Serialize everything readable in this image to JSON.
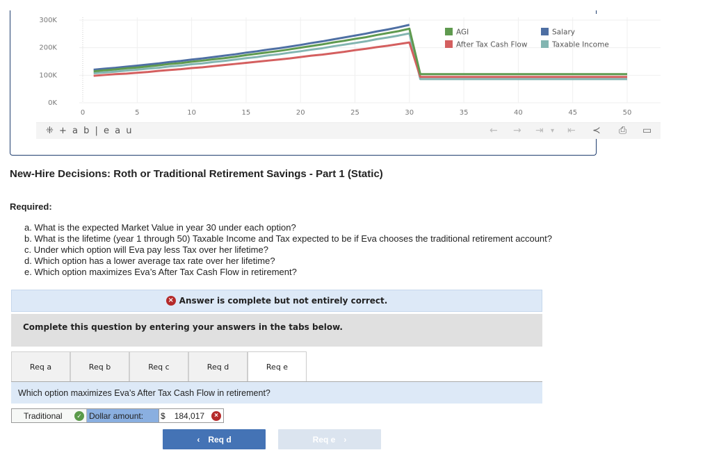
{
  "chart_data": {
    "type": "line",
    "title": "",
    "xlabel": "",
    "ylabel": "",
    "xlim": [
      -3,
      53
    ],
    "ylim": [
      0,
      300000
    ],
    "x_ticks": [
      0,
      5,
      10,
      15,
      20,
      25,
      30,
      35,
      40,
      45,
      50
    ],
    "x_tick_labels": [
      "0",
      "5",
      "10",
      "15",
      "20",
      "25",
      "30",
      "35",
      "40",
      "45",
      "50"
    ],
    "y_ticks": [
      0,
      100000,
      200000,
      300000
    ],
    "y_tick_labels": [
      "0K",
      "100K",
      "200K",
      "300K"
    ],
    "grid": true,
    "legend_position": "top-right",
    "series": [
      {
        "name": "Salary",
        "color": "#4e6fa3",
        "x": [
          1,
          2,
          3,
          4,
          5,
          6,
          7,
          8,
          9,
          10,
          11,
          12,
          13,
          14,
          15,
          16,
          17,
          18,
          19,
          20,
          21,
          22,
          23,
          24,
          25,
          26,
          27,
          28,
          29,
          30
        ],
        "values": [
          120000,
          124000,
          127000,
          131000,
          135000,
          139000,
          143000,
          148000,
          152000,
          157000,
          161000,
          166000,
          171000,
          176000,
          182000,
          187000,
          193000,
          198000,
          204000,
          210000,
          217000,
          223000,
          230000,
          237000,
          244000,
          251000,
          259000,
          266000,
          274000,
          283000
        ]
      },
      {
        "name": "AGI",
        "color": "#5f9a4f",
        "x": [
          1,
          2,
          3,
          4,
          5,
          6,
          7,
          8,
          9,
          10,
          11,
          12,
          13,
          14,
          15,
          16,
          17,
          18,
          19,
          20,
          21,
          22,
          23,
          24,
          25,
          26,
          27,
          28,
          29,
          30,
          31,
          32,
          33,
          34,
          35,
          36,
          37,
          38,
          39,
          40,
          41,
          42,
          43,
          44,
          45,
          46,
          47,
          48,
          49,
          50
        ],
        "values": [
          114000,
          118000,
          121000,
          125000,
          128000,
          132000,
          136000,
          141000,
          144000,
          149000,
          153000,
          158000,
          162000,
          167000,
          173000,
          178000,
          183000,
          188000,
          194000,
          200000,
          206000,
          212000,
          219000,
          225000,
          232000,
          238000,
          246000,
          253000,
          260000,
          269000,
          104000,
          104000,
          104000,
          104000,
          104000,
          104000,
          104000,
          104000,
          104000,
          104000,
          104000,
          104000,
          104000,
          104000,
          104000,
          104000,
          104000,
          104000,
          104000,
          104000
        ]
      },
      {
        "name": "Taxable Income",
        "color": "#82b5b1",
        "x": [
          1,
          2,
          3,
          4,
          5,
          6,
          7,
          8,
          9,
          10,
          11,
          12,
          13,
          14,
          15,
          16,
          17,
          18,
          19,
          20,
          21,
          22,
          23,
          24,
          25,
          26,
          27,
          28,
          29,
          30,
          31,
          32,
          33,
          34,
          35,
          36,
          37,
          38,
          39,
          40,
          41,
          42,
          43,
          44,
          45,
          46,
          47,
          48,
          49,
          50
        ],
        "values": [
          107000,
          110000,
          113000,
          117000,
          120000,
          124000,
          127000,
          132000,
          135000,
          140000,
          143000,
          148000,
          152000,
          157000,
          162000,
          166000,
          172000,
          176000,
          182000,
          187000,
          193000,
          198000,
          205000,
          211000,
          217000,
          223000,
          231000,
          237000,
          244000,
          252000,
          86000,
          86000,
          86000,
          86000,
          86000,
          86000,
          86000,
          86000,
          86000,
          86000,
          86000,
          86000,
          86000,
          86000,
          86000,
          86000,
          86000,
          86000,
          86000,
          86000
        ]
      },
      {
        "name": "After Tax Cash Flow",
        "color": "#d45f5f",
        "x": [
          1,
          2,
          3,
          4,
          5,
          6,
          7,
          8,
          9,
          10,
          11,
          12,
          13,
          14,
          15,
          16,
          17,
          18,
          19,
          20,
          21,
          22,
          23,
          24,
          25,
          26,
          27,
          28,
          29,
          30,
          31,
          32,
          33,
          34,
          35,
          36,
          37,
          38,
          39,
          40,
          41,
          42,
          43,
          44,
          45,
          46,
          47,
          48,
          49,
          50
        ],
        "values": [
          98000,
          101000,
          104000,
          106000,
          109000,
          112000,
          116000,
          119000,
          122000,
          126000,
          129000,
          133000,
          137000,
          141000,
          145000,
          149000,
          153000,
          157000,
          161000,
          166000,
          171000,
          175000,
          180000,
          185000,
          191000,
          196000,
          202000,
          207000,
          213000,
          219000,
          94000,
          94000,
          94000,
          94000,
          94000,
          94000,
          94000,
          94000,
          94000,
          94000,
          94000,
          94000,
          94000,
          94000,
          94000,
          94000,
          94000,
          94000,
          94000,
          94000
        ]
      }
    ],
    "legend": [
      {
        "name": "AGI",
        "color": "#5f9a4f"
      },
      {
        "name": "Salary",
        "color": "#4e6fa3"
      },
      {
        "name": "After Tax Cash Flow",
        "color": "#d45f5f"
      },
      {
        "name": "Taxable Income",
        "color": "#82b5b1"
      }
    ]
  },
  "tableau_toolbar": {
    "logo": "+ a b | e a u",
    "icons": [
      "undo-arrow",
      "redo-arrow",
      "revert",
      "dropdown",
      "reset",
      "share",
      "download",
      "fullscreen"
    ],
    "glyphs": {
      "undo": "←",
      "redo": "→",
      "revert": "⇥",
      "dropdown": "▾",
      "reset": "⇤",
      "share": "≺",
      "download": "⎙",
      "fullscreen": "▭"
    }
  },
  "page": {
    "title": "New-Hire Decisions: Roth or Traditional Retirement Savings - Part 1 (Static)",
    "required_label": "Required:",
    "requirements": [
      "a. What is the expected Market Value in year 30 under each option?",
      "b. What is the lifetime (year 1 through 50) Taxable Income and Tax expected to be if Eva chooses the traditional retirement account?",
      "c. Under which option will Eva pay less Tax over her lifetime?",
      "d. Which option has a lower average tax rate over her lifetime?",
      "e. Which option maximizes Eva’s After Tax Cash Flow in retirement?"
    ]
  },
  "status": {
    "icon": "×",
    "message": "Answer is complete but not entirely correct.",
    "error_color": "#b52a2a"
  },
  "instructions": "Complete this question by entering your answers in the tabs below.",
  "tabs": [
    {
      "label": "Req a",
      "active": false
    },
    {
      "label": "Req b",
      "active": false
    },
    {
      "label": "Req c",
      "active": false
    },
    {
      "label": "Req d",
      "active": false
    },
    {
      "label": "Req e",
      "active": true
    }
  ],
  "question": "Which option maximizes Eva’s After Tax Cash Flow in retirement?",
  "answer": {
    "choice": "Traditional",
    "choice_correct": true,
    "check_icon": "✓",
    "amount_label": "Dollar amount:",
    "currency": "$",
    "amount_value": "184,017",
    "amount_correct": false,
    "x_icon": "×"
  },
  "navigation": {
    "prev_label": "Req d",
    "prev_glyph": "‹",
    "next_label": "Req e",
    "next_glyph": "›"
  }
}
